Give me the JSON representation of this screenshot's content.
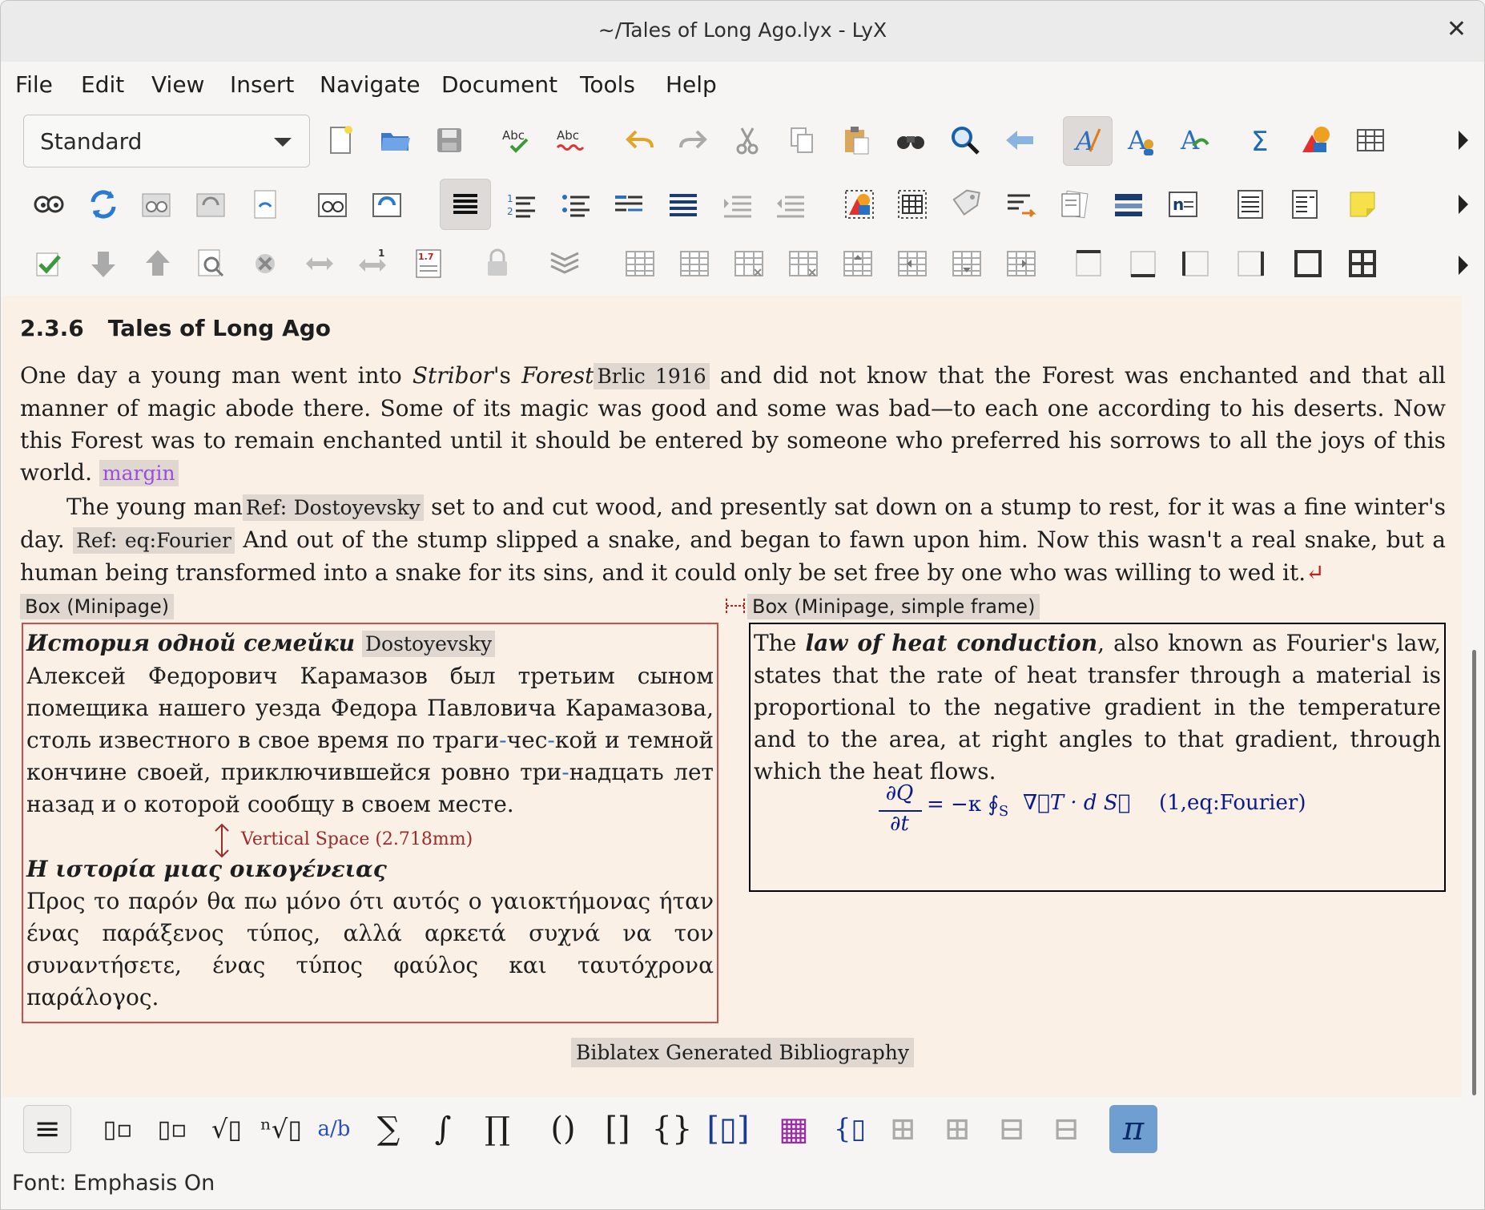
{
  "window": {
    "title": "~/Tales of Long Ago.lyx - LyX",
    "close_glyph": "✕"
  },
  "menu": [
    {
      "label": "File"
    },
    {
      "label": "Edit"
    },
    {
      "label": "View"
    },
    {
      "label": "Insert"
    },
    {
      "label": "Navigate"
    },
    {
      "label": "Document"
    },
    {
      "label": "Tools"
    },
    {
      "label": "Help"
    }
  ],
  "toolbar": {
    "paragraph_style": "Standard"
  },
  "icons": {
    "row1": [
      "new-document-icon",
      "open-icon",
      "save-icon",
      "spellcheck-icon",
      "spellcheck-continuous-icon",
      "undo-icon",
      "redo-icon",
      "cut-icon",
      "copy-icon",
      "paste-icon",
      "find-icon",
      "find-replace-icon",
      "back-icon",
      "emphasis-icon",
      "noun-icon",
      "text-style-icon",
      "math-icon",
      "insert-graphics-icon",
      "insert-table-icon"
    ],
    "row2": [
      "view-icon",
      "update-icon",
      "view-master-icon",
      "update-master-icon",
      "view-other-icon",
      "view-source-icon",
      "update-source-icon",
      "align-justify-icon",
      "enumerate-icon",
      "itemize-icon",
      "description-icon",
      "list-icon",
      "depth-increase-icon",
      "depth-decrease-icon",
      "insert-figure-icon",
      "insert-table-float-icon",
      "label-icon",
      "cross-ref-icon",
      "citation-icon",
      "index-icon",
      "nomenclature-icon",
      "footnote-icon",
      "marginal-note-icon",
      "note-icon"
    ],
    "row3": [
      "accept-change-icon",
      "next-change-icon",
      "previous-change-icon",
      "review-icon",
      "reject-change-icon",
      "merge-icon",
      "compare-icon",
      "version-icon",
      "lock-icon",
      "layers-icon",
      "table-append-row-icon",
      "table-append-column-icon",
      "table-delete-row-icon",
      "table-delete-column-icon",
      "table-move-up-icon",
      "table-move-left-icon",
      "table-move-down-icon",
      "table-move-right-icon",
      "border-top-icon",
      "border-bottom-icon",
      "border-left-icon",
      "border-right-icon",
      "border-outer-icon",
      "border-all-icon"
    ]
  },
  "document": {
    "heading_number": "2.3.6",
    "heading_title": "Tales of Long Ago",
    "p1_a": "One day a young man went into ",
    "p1_b": "Stribor",
    "p1_c": "'s ",
    "p1_d": "Forest",
    "cite1": "Brlic 1916",
    "p1_e": " and did not know that the Forest was enchanted and that all manner of magic abode there. Some of its magic was good and some was bad—to each one according to his deserts. Now this Forest was to remain enchanted until it should be entered by someone who preferred his sorrows to all the joys of this world. ",
    "margin_note": "margin",
    "p2_a": "The young man",
    "ref1": "Ref: Dostoyevsky",
    "p2_b": " set to and cut wood, and presently sat down on a stump to rest, for it was a fine winter's day. ",
    "ref2": "Ref: eq:Fourier",
    "p2_c": " And out of the stump slipped a snake, and began to fawn upon him. Now this wasn't a real snake, but a human being transformed into a snake for its sins, and it could only be set free by one who was willing to wed it.",
    "end_mark": "↵",
    "box_left_label": "Box (Minipage)",
    "box_right_label": "Box (Minipage, simple frame)",
    "ru_title": "История одной семейки",
    "ru_label": "Dostoyevsky",
    "ru_text_a": "Алексей Федорович Карамазов был третьим сыном помещика нашего уезда Федора Павловича Карамазова, столь известного в свое время по траги",
    "hy1": "-",
    "ru_text_b": "чес",
    "hy2": "-",
    "ru_text_c": "кой и темной кончине своей, приключившейся ровно три",
    "hy3": "-",
    "ru_text_d": "надцать лет назад и о которой сообщу в своем месте.",
    "vspace": "Vertical Space (2.718mm)",
    "gr_title": "Η ιστορία μιας οικογένειας",
    "gr_text": "Προς το παρόν θα πω μόνο ότι αυτός ο γαιοκτήμονας ήταν ένας παράξενος τύπος, αλλά αρκετά συχνά να τον συναντήσετε, ένας τύπος φαύλος και ταυτόχρονα παράλογος.",
    "en_a": "The ",
    "en_bold": "law of heat conduction",
    "en_b": ", also known as Fourier's law, states that the rate of heat transfer through a material is proportional to the negative gradient in the temperature and to the area, at right angles to that gradient, through which the heat flows.",
    "eq_num": "(1,eq:Fourier)",
    "eq_numerator": "∂Q",
    "eq_denominator": "∂t",
    "eq_rhs": "= −κ ∮",
    "eq_sub": "S",
    "eq_tail": "∇⃗T · d S⃗",
    "bibliography": "Biblatex Generated Bibliography"
  },
  "math_toolbar": {
    "items": [
      "≡",
      "▯▫",
      "▯▫",
      "√▯",
      "ⁿ√▯",
      "a/b",
      "∑",
      "∫",
      "∏",
      "()",
      "[]",
      "{}",
      "[▯]",
      "▦",
      "{▯",
      "⊞",
      "⊞",
      "⊟",
      "⊟",
      "π"
    ]
  },
  "status": "Font: Emphasis On",
  "colors": {
    "doc_background": "#faf0e6",
    "inset_background": "#e0d8d0",
    "math_blue": "#0a1a8a",
    "left_box_border": "#c8504a"
  }
}
